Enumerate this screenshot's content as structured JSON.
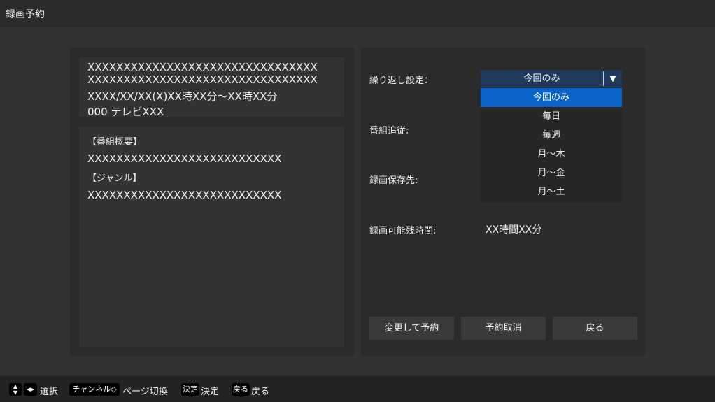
{
  "window": {
    "title": "録画予約"
  },
  "program": {
    "title_line1": "XXXXXXXXXXXXXXXXXXXXXXXXXXXXXXXX",
    "title_line2": "XXXXXXXXXXXXXXXXXXXXXXXXXXXXXXXX",
    "datetime": "XXXX/XX/XX(X)XX時XX分〜XX時XX分",
    "channel": "000 テレビXXX",
    "summary_heading": "【番組概要】",
    "summary_text": "XXXXXXXXXXXXXXXXXXXXXXXXXXX",
    "genre_heading": "【ジャンル】",
    "genre_text": "XXXXXXXXXXXXXXXXXXXXXXXXXXX"
  },
  "settings": {
    "repeat_label": "繰り返し設定：",
    "repeat_selected": "今回のみ",
    "repeat_options": [
      "今回のみ",
      "毎日",
      "毎週",
      "月〜木",
      "月〜金",
      "月〜土"
    ],
    "follow_label": "番組追従:",
    "save_location_label": "録画保存先:",
    "remaining_label": "録画可能残時間:",
    "remaining_value": "XX時間XX分"
  },
  "buttons": {
    "change": "変更して予約",
    "cancel": "予約取消",
    "back": "戻る"
  },
  "footer": {
    "key_updown": "▲▼",
    "key_leftright": "◂▸",
    "select_label": "選択",
    "key_channel": "チャンネル◇",
    "page_label": "ページ切換",
    "key_enter": "決定",
    "enter_label": "決定",
    "key_back": "戻る",
    "back_label": "戻る"
  },
  "colors": {
    "background": "#333333",
    "panel": "#2b2b2b",
    "select_bg": "#213a5c",
    "highlight": "#0a64c8"
  }
}
